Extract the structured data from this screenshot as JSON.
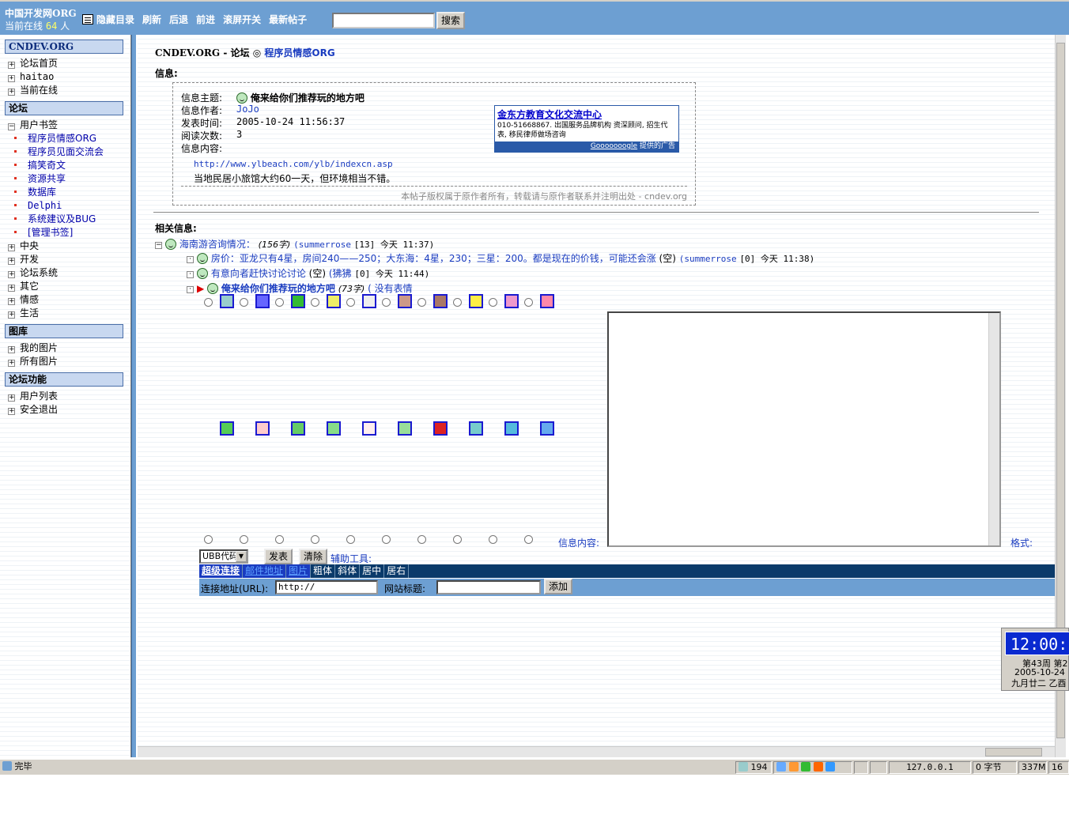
{
  "topbar": {
    "site_title": "中国开发网ORG",
    "online_prefix": "当前在线",
    "online_count": "64",
    "online_suffix": "人",
    "buttons": [
      "隐藏目录",
      "刷新",
      "后退",
      "前进",
      "滚屏开关",
      "最新帖子"
    ],
    "search_value": "",
    "search_button": "搜索"
  },
  "sidebar": {
    "header_site": "CNDEV.ORG",
    "site_items": [
      "论坛首页",
      "haitao",
      "当前在线"
    ],
    "header_forum": "论坛",
    "bookmarks_label": "用户书签",
    "bookmarks": [
      "程序员情感ORG",
      "程序员见面交流会",
      "搞笑奇文",
      "资源共享",
      "数据库",
      "Delphi",
      "系统建议及BUG",
      "[管理书签]"
    ],
    "forum_groups": [
      "中央",
      "开发",
      "论坛系统",
      "其它",
      "情感",
      "生活"
    ],
    "header_gallery": "图库",
    "gallery_items": [
      "我的图片",
      "所有图片"
    ],
    "header_functions": "论坛功能",
    "function_items": [
      "用户列表",
      "安全退出"
    ]
  },
  "breadcrumb": {
    "site": "CNDEV.ORG",
    "sep1": "-",
    "forum_label": "论坛",
    "sep2": "◎",
    "board": "程序员情感ORG"
  },
  "info": {
    "section_label": "信息:",
    "subject_label": "信息主题:",
    "subject": "俺来给你们推荐玩的地方吧",
    "author_label": "信息作者:",
    "author": "JoJo",
    "time_label": "发表时间:",
    "time": "2005-10-24 11:56:37",
    "reads_label": "阅读次数:",
    "reads": "3",
    "content_label": "信息内容:",
    "link": "http://www.ylbeach.com/ylb/indexcn.asp",
    "body": "当地民居小旅馆大约60一天，但环境相当不错。",
    "copyright": "本帖子版权属于原作者所有，转载请与原作者联系并注明出处 - cndev.org"
  },
  "ad": {
    "title": "金东方教育文化交流中心",
    "body": "010-51668867. 出国服务品牌机构 资深顾问, 招生代表, 移民律师做场咨询",
    "footer_link": "Gooooooogle",
    "footer_text": "提供的广告"
  },
  "related": {
    "label": "相关信息:",
    "root_title": "海南游咨询情况：",
    "root_size": "(156字)",
    "root_author": "(summerrose",
    "root_meta": "[13] 今天 11:37)",
    "reply1_title": "房价：亚龙只有4星，房间240——250；大东海：4星，230；三星：200。都是现在的价钱，可能还会涨",
    "reply1_size": "(空)",
    "reply1_author": "(summerrose",
    "reply1_meta": "[0] 今天 11:38)",
    "reply2_title": "有意向者赶快讨论讨论",
    "reply2_size": "(空)",
    "reply2_author": "(狒狒",
    "reply2_meta": "[0] 今天 11:44)",
    "reply3_title": "俺来给你们推荐玩的地方吧",
    "reply3_size": "(73字)",
    "reply3_extra": "( 没有表情"
  },
  "editor": {
    "content_label": "信息内容:",
    "format_label": "格式:",
    "ubb_select": "UBB代码",
    "post_button": "发表",
    "clear_button": "清除",
    "aux_label": "辅助工具:",
    "format_tabs": [
      "超级连接",
      "邮件地址",
      "图片",
      "粗体",
      "斜体",
      "居中",
      "居右"
    ],
    "url_label": "连接地址(URL):",
    "url_value": "http://",
    "site_title_label": "网站标题:",
    "site_title_value": "",
    "add_button": "添加"
  },
  "clock": {
    "time": "12:00:",
    "week": "第43周 第2",
    "date": "2005-10-24",
    "lunar": "九月廿二 乙酉"
  },
  "statusbar": {
    "status": "完毕",
    "count": "194",
    "ip": "127.0.0.1",
    "bytes": "0 字节",
    "memory": "337M",
    "extra": "16"
  }
}
